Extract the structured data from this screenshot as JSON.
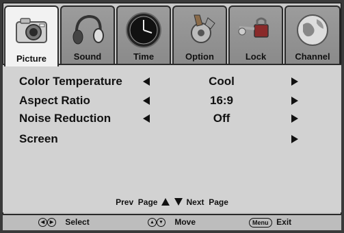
{
  "tabs": [
    {
      "label": "Picture",
      "icon": "camera-icon",
      "active": true
    },
    {
      "label": "Sound",
      "icon": "headphones-icon",
      "active": false
    },
    {
      "label": "Time",
      "icon": "clock-icon",
      "active": false
    },
    {
      "label": "Option",
      "icon": "gear-drill-icon",
      "active": false
    },
    {
      "label": "Lock",
      "icon": "padlock-keys-icon",
      "active": false
    },
    {
      "label": "Channel",
      "icon": "globe-icon",
      "active": false
    }
  ],
  "settings": [
    {
      "name": "Color Temperature",
      "value": "Cool"
    },
    {
      "name": "Aspect Ratio",
      "value": "16:9"
    },
    {
      "name": "Noise Reduction",
      "value": "Off"
    },
    {
      "name": "Screen",
      "value": ""
    }
  ],
  "pager": {
    "prev": "Prev",
    "page1": "Page",
    "next": "Next",
    "page2": "Page"
  },
  "footer": {
    "select": "Select",
    "move": "Move",
    "menu_key": "Menu",
    "exit": "Exit"
  },
  "colors": {
    "active_tab": "#f2f2f2",
    "tab": "#8f8f8f",
    "panel": "#d2d2d2",
    "text": "#111111"
  }
}
